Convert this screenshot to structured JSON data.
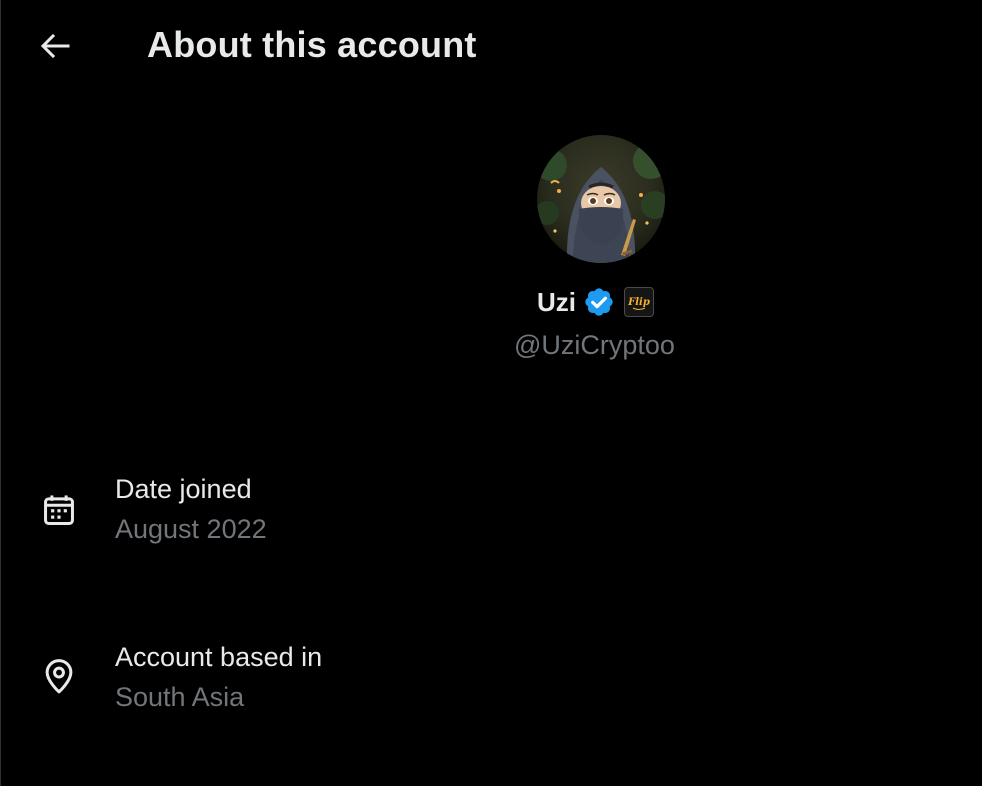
{
  "header": {
    "back_icon": "arrow-left-icon",
    "title": "About this account"
  },
  "profile": {
    "avatar_icon": "profile-avatar",
    "display_name": "Uzi",
    "verified_icon": "verified-badge-icon",
    "verified_color": "#1d9bf0",
    "affiliate_icon": "affiliate-badge-icon",
    "affiliate_text": "Flip",
    "handle": "@UziCryptoo"
  },
  "details": [
    {
      "icon": "calendar-icon",
      "label": "Date joined",
      "value": "August 2022"
    },
    {
      "icon": "location-pin-icon",
      "label": "Account based in",
      "value": "South Asia"
    }
  ],
  "colors": {
    "background": "#000000",
    "primary_text": "#e7e9ea",
    "secondary_text": "#71767b"
  }
}
